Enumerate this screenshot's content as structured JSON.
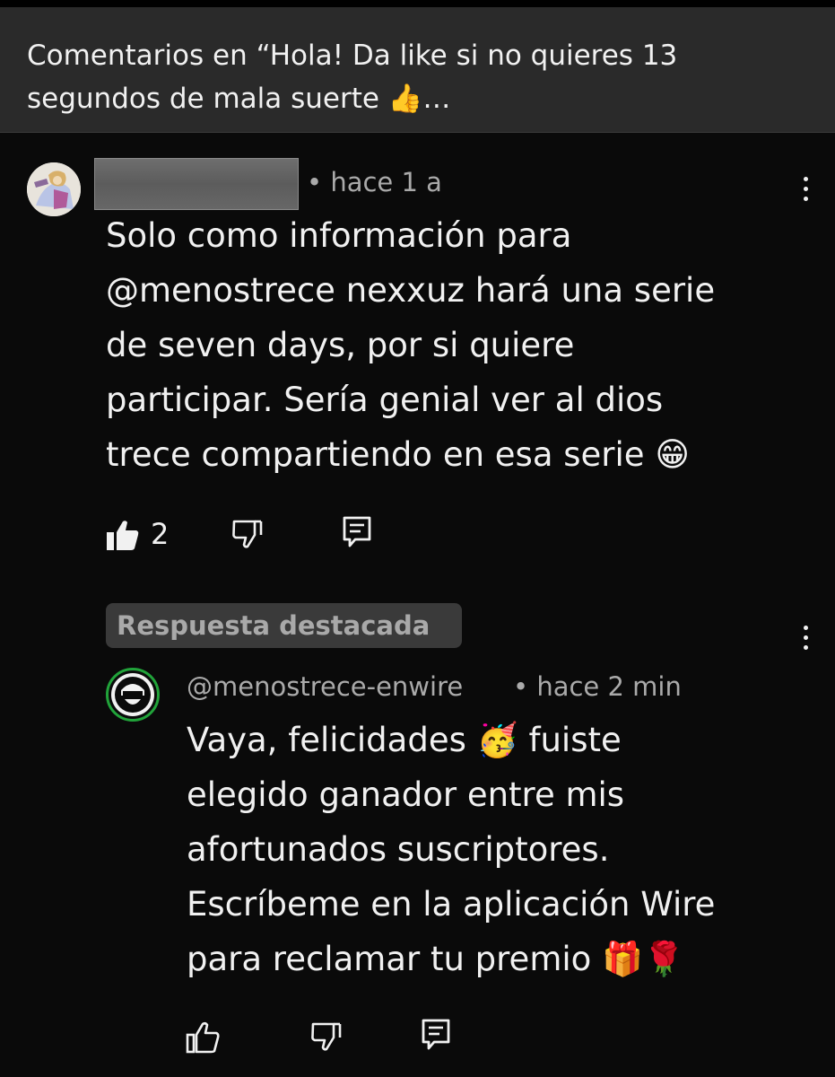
{
  "header": {
    "title": "Comentarios en “Hola! Da like si no quieres 13 segundos de mala suerte 👍…"
  },
  "comment": {
    "time": "• hace 1 a",
    "text": "Solo como información para\n@menostrece nexxuz hará una serie\nde seven days, por si quiere\nparticipar. Sería genial ver al dios\ntrece compartiendo en esa serie 😁",
    "likes": "2"
  },
  "reply": {
    "badge": "Respuesta destacada",
    "author": "@menostrece-enwire",
    "time": "• hace 2 min",
    "text": "Vaya, felicidades 🥳 fuiste\nelegido ganador entre mis\nafortunados suscriptores.\nEscríbeme en la aplicación Wire\npara reclamar tu premio 🎁🌹"
  },
  "icons": {
    "like": "thumbs-up-icon",
    "dislike": "thumbs-down-icon",
    "reply": "reply-icon",
    "more": "more-vertical-icon"
  },
  "colors": {
    "background": "#0a0a0a",
    "header_background": "#2a2a2a",
    "meta_text": "#aaaaaa",
    "badge_background": "#3a3a3a",
    "avatar_ring": "#21a33a"
  }
}
